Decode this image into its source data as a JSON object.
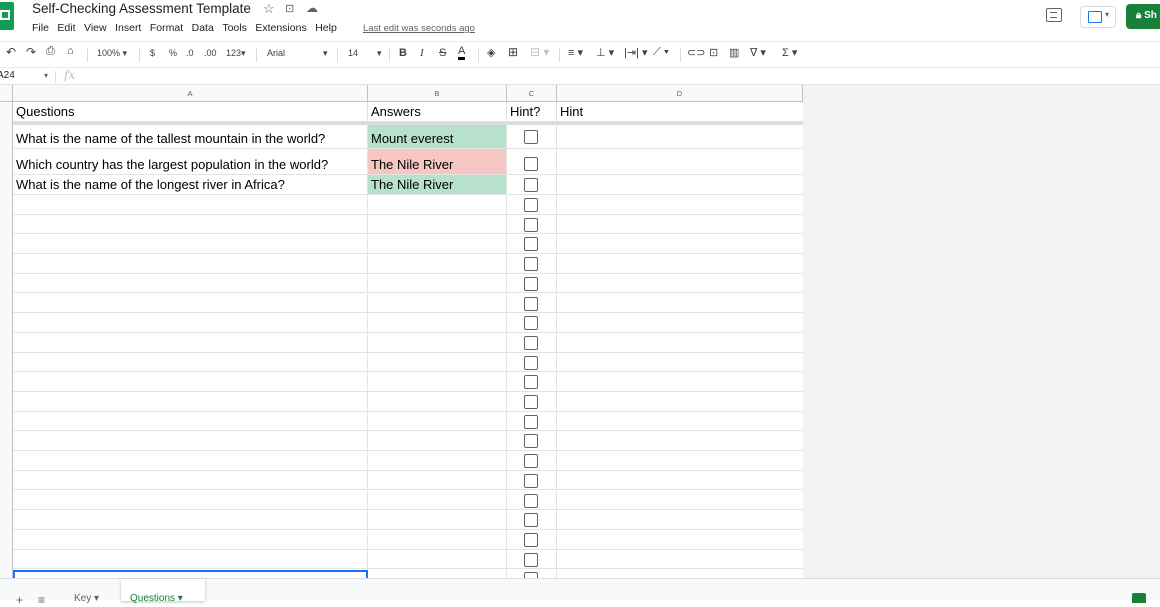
{
  "header": {
    "title": "Self-Checking Assessment Template",
    "menu": [
      "File",
      "Edit",
      "View",
      "Insert",
      "Format",
      "Data",
      "Tools",
      "Extensions",
      "Help"
    ],
    "last_edit": "Last edit was seconds ago",
    "share_label": "Sh"
  },
  "toolbar": {
    "zoom": "100%",
    "currency": "$",
    "percent": "%",
    "decrease_decimal": ".0",
    "increase_decimal": ".00",
    "more_formats": "123",
    "font": "Arial",
    "font_size": "14",
    "bold": "B",
    "italic": "I",
    "strikethrough": "S",
    "text_color": "A",
    "functions": "Σ"
  },
  "formula_bar": {
    "name_box": "A24",
    "fx": "fx"
  },
  "columns": [
    "A",
    "B",
    "C",
    "D"
  ],
  "header_row": {
    "questions": "Questions",
    "answers": "Answers",
    "hint_check": "Hint?",
    "hint": "Hint"
  },
  "rows": [
    {
      "question": "What is the name of the tallest mountain in the world?",
      "answer": "Mount everest",
      "status": "correct",
      "checked": false
    },
    {
      "question": "Which country has the largest population in the world?",
      "answer": "The Nile River",
      "status": "wrong",
      "checked": false
    },
    {
      "question": "What is the name of the longest river in Africa?",
      "answer": "The Nile River",
      "status": "correct",
      "checked": false
    }
  ],
  "sheet_tabs": {
    "key": "Key",
    "questions": "Questions"
  },
  "colors": {
    "correct": "#b7e1cd",
    "wrong": "#f4c7c3",
    "accent": "#1a73e8",
    "brand": "#188038"
  }
}
